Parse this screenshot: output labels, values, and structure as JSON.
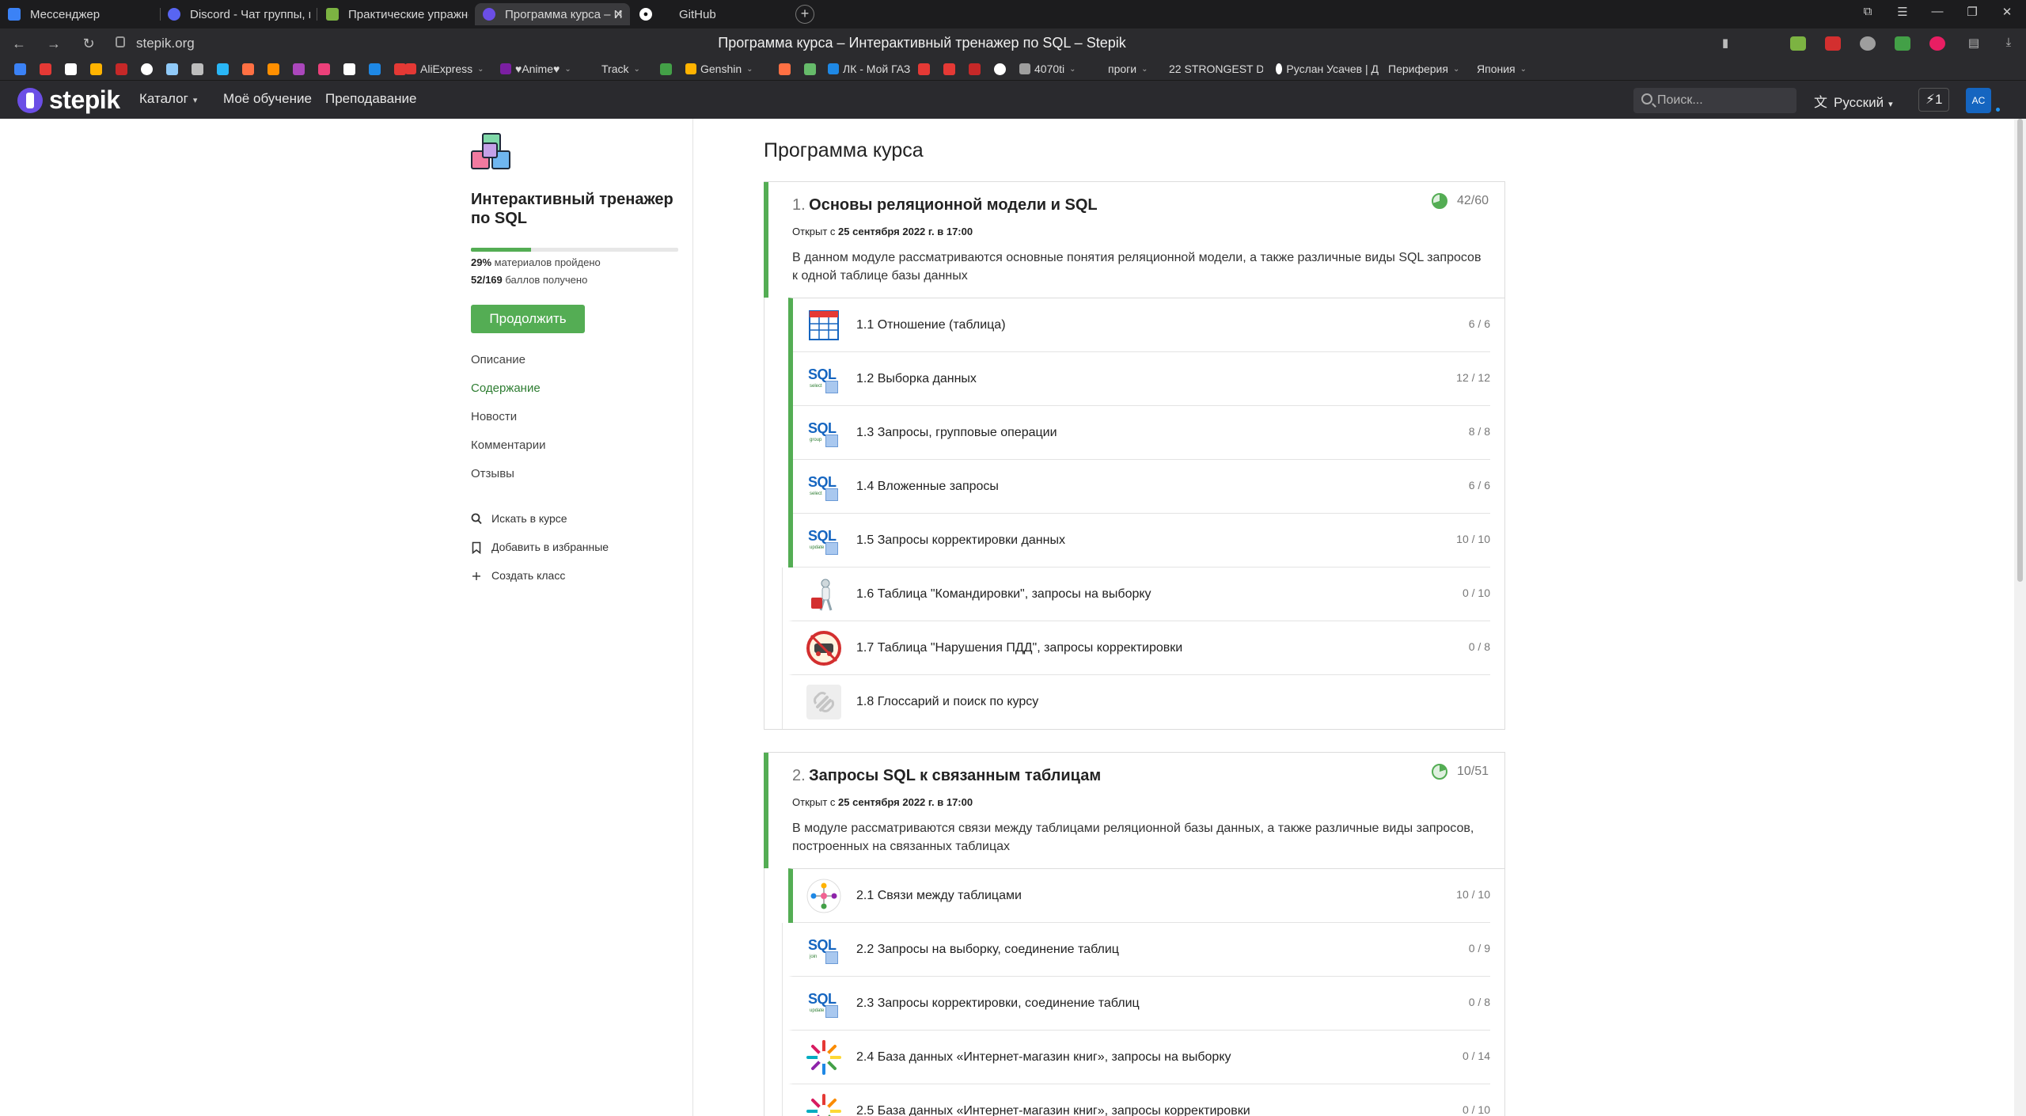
{
  "browser": {
    "tabs": [
      {
        "label": "Мессенджер",
        "icon": "messenger-icon",
        "color": "#3b82f6"
      },
      {
        "label": "Discord - Чат группы, где",
        "icon": "discord-icon",
        "color": "#5865f2"
      },
      {
        "label": "Практические упражнен",
        "icon": "sheet-icon",
        "color": "#7cb342"
      },
      {
        "label": "Программа курса – И",
        "icon": "stepik-icon",
        "color": "#6b4ee6",
        "active": true
      },
      {
        "label": "GitHub",
        "icon": "github-icon",
        "color": "#ffffff"
      }
    ],
    "url": "stepik.org",
    "page_title": "Программа курса – Интерактивный тренажер по SQL – Stepik",
    "bookmarks": [
      {
        "label": "AliExpress",
        "dropdown": true,
        "color": "#e53935"
      },
      {
        "label": "♥Anime♥",
        "dropdown": true,
        "color": "#7b1fa2"
      },
      {
        "label": "Track",
        "dropdown": true,
        "color": ""
      },
      {
        "label": "Genshin",
        "dropdown": true,
        "color": "#ffb300"
      },
      {
        "label": "ЛК - Мой ГАЗ",
        "dropdown": false,
        "color": "#1e88e5"
      },
      {
        "label": "4070ti",
        "dropdown": true,
        "color": "#9e9e9e"
      },
      {
        "label": "проги",
        "dropdown": true,
        "color": ""
      },
      {
        "label": "22 STRONGEST D",
        "dropdown": false,
        "color": "#e53935"
      },
      {
        "label": "Руслан Усачев | Д",
        "dropdown": false,
        "color": "#ffffff"
      },
      {
        "label": "Периферия",
        "dropdown": true,
        "color": ""
      },
      {
        "label": "Япония",
        "dropdown": true,
        "color": ""
      }
    ]
  },
  "header": {
    "logo": "stepik",
    "nav": [
      {
        "label": "Каталог",
        "dropdown": true
      },
      {
        "label": "Моё обучение",
        "dropdown": false
      },
      {
        "label": "Преподавание",
        "dropdown": false
      }
    ],
    "search_placeholder": "Поиск...",
    "language": "Русский",
    "notifications": "1",
    "avatar": "AC"
  },
  "sidebar": {
    "course_title": "Интерактивный тренажер по SQL",
    "progress_percent": 29,
    "progress_text_pct": "29%",
    "progress_text_rest": "материалов пройдено",
    "points_value": "52/169",
    "points_rest": "баллов получено",
    "continue_label": "Продолжить",
    "nav": [
      "Описание",
      "Содержание",
      "Новости",
      "Комментарии",
      "Отзывы"
    ],
    "active_nav": "Содержание",
    "actions": [
      "Искать в курсе",
      "Добавить в избранные",
      "Создать класс"
    ]
  },
  "main": {
    "page_title": "Программа курса",
    "modules": [
      {
        "num": "1.",
        "title": "Основы реляционной модели и SQL",
        "score": "42/60",
        "progress": 0.7,
        "open_prefix": "Открыт с",
        "open_date": "25 сентября 2022 г. в 17:00",
        "description": "В данном модуле рассматриваются основные понятия реляционной модели, а также различные виды SQL запросов к одной таблице базы данных",
        "lessons": [
          {
            "title": "1.1 Отношение (таблица)",
            "score": "6 / 6",
            "done": true,
            "icon": "table"
          },
          {
            "title": "1.2 Выборка данных",
            "score": "12 / 12",
            "done": true,
            "icon": "sql"
          },
          {
            "title": "1.3 Запросы, групповые операции",
            "score": "8 / 8",
            "done": true,
            "icon": "sql"
          },
          {
            "title": "1.4 Вложенные запросы",
            "score": "6 / 6",
            "done": true,
            "icon": "sql"
          },
          {
            "title": "1.5 Запросы корректировки данных",
            "score": "10 / 10",
            "done": true,
            "icon": "sql"
          },
          {
            "title": "1.6 Таблица \"Командировки\", запросы на выборку",
            "score": "0 / 10",
            "done": false,
            "icon": "traveler"
          },
          {
            "title": "1.7 Таблица \"Нарушения ПДД\", запросы корректировки",
            "score": "0 / 8",
            "done": false,
            "icon": "traffic"
          },
          {
            "title": "1.8 Глоссарий и поиск по курсу",
            "score": "",
            "done": false,
            "icon": "glossary"
          }
        ]
      },
      {
        "num": "2.",
        "title": "Запросы SQL к связанным таблицам",
        "score": "10/51",
        "progress": 0.2,
        "open_prefix": "Открыт с",
        "open_date": "25 сентября 2022 г. в 17:00",
        "description": "В модуле рассматриваются связи между таблицами реляционной базы данных, а также различные виды запросов, построенных на связанных таблицах",
        "lessons": [
          {
            "title": "2.1 Связи между таблицами",
            "score": "10 / 10",
            "done": true,
            "icon": "network"
          },
          {
            "title": "2.2 Запросы на выборку, соединение таблиц",
            "score": "0 / 9",
            "done": false,
            "icon": "sql"
          },
          {
            "title": "2.3 Запросы корректировки, соединение таблиц",
            "score": "0 / 8",
            "done": false,
            "icon": "sql"
          },
          {
            "title": "2.4 База данных «Интернет-магазин книг», запросы на выборку",
            "score": "0 / 14",
            "done": false,
            "icon": "book"
          },
          {
            "title": "2.5 База данных «Интернет-магазин книг», запросы корректировки",
            "score": "0 / 10",
            "done": false,
            "icon": "book"
          }
        ]
      }
    ]
  },
  "colors": {
    "accent_green": "#54ad54",
    "header_bg": "#2a2a2e",
    "chrome_bg": "#1c1c1e",
    "logo_purple": "#6b4ee6"
  }
}
